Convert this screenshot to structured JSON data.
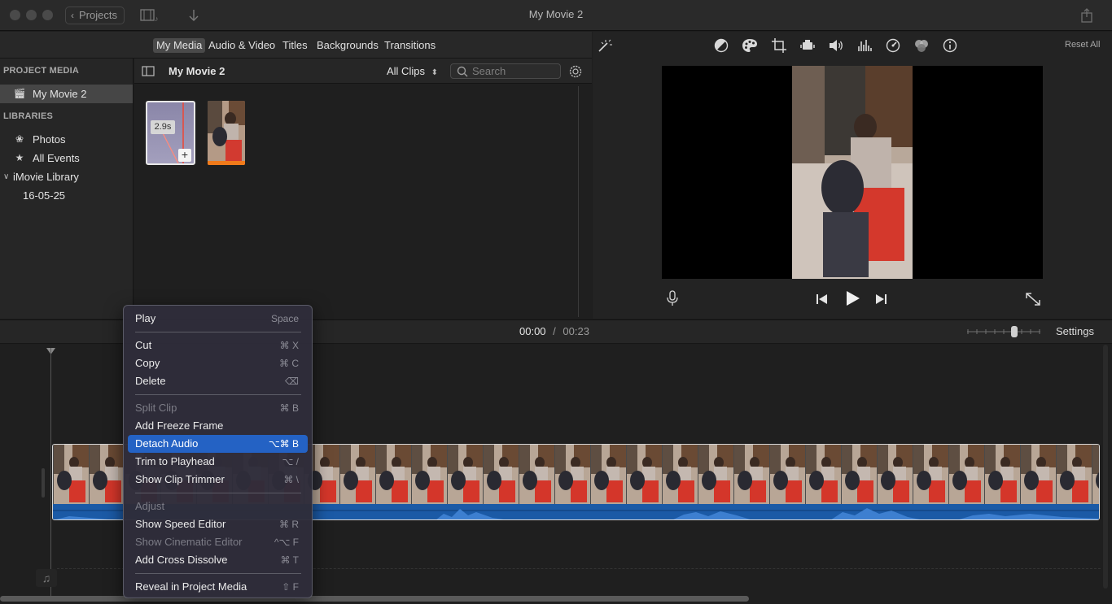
{
  "window": {
    "title": "My Movie 2",
    "projects_label": "Projects"
  },
  "media_tabs": [
    {
      "label": "My Media",
      "active": true
    },
    {
      "label": "Audio & Video"
    },
    {
      "label": "Titles"
    },
    {
      "label": "Backgrounds"
    },
    {
      "label": "Transitions"
    }
  ],
  "sidebar": {
    "project_media_heading": "PROJECT MEDIA",
    "project_item": "My Movie 2",
    "libraries_heading": "LIBRARIES",
    "photos": "Photos",
    "all_events": "All Events",
    "library": "iMovie Library",
    "event": "16-05-25"
  },
  "browser": {
    "title": "My Movie 2",
    "filter": "All Clips",
    "search_placeholder": "Search",
    "clip1_duration": "2.9s"
  },
  "viewer": {
    "reset_all": "Reset All"
  },
  "timeline": {
    "current_time": "00:00",
    "separator": "/",
    "duration": "00:23",
    "settings_label": "Settings"
  },
  "context_menu": {
    "items": [
      {
        "label": "Play",
        "shortcut": "Space",
        "enabled": true
      },
      {
        "label": "Cut",
        "shortcut": "⌘ X",
        "enabled": true
      },
      {
        "label": "Copy",
        "shortcut": "⌘ C",
        "enabled": true
      },
      {
        "label": "Delete",
        "shortcut": "⌫",
        "enabled": true
      },
      {
        "label": "Split Clip",
        "shortcut": "⌘ B",
        "enabled": false
      },
      {
        "label": "Add Freeze Frame",
        "shortcut": "",
        "enabled": true
      },
      {
        "label": "Detach Audio",
        "shortcut": "⌥⌘ B",
        "enabled": true,
        "highlighted": true
      },
      {
        "label": "Trim to Playhead",
        "shortcut": "⌥ /",
        "enabled": true
      },
      {
        "label": "Show Clip Trimmer",
        "shortcut": "⌘ \\",
        "enabled": true
      },
      {
        "label": "Adjust",
        "shortcut": "",
        "enabled": false
      },
      {
        "label": "Show Speed Editor",
        "shortcut": "⌘ R",
        "enabled": true
      },
      {
        "label": "Show Cinematic Editor",
        "shortcut": "^⌥ F",
        "enabled": false
      },
      {
        "label": "Add Cross Dissolve",
        "shortcut": "⌘ T",
        "enabled": true
      },
      {
        "label": "Reveal in Project Media",
        "shortcut": "⇧ F",
        "enabled": true
      }
    ]
  },
  "colors": {
    "highlight": "#2462c4",
    "audio_track": "#1b5aa6",
    "background": "#1e1e1e"
  }
}
